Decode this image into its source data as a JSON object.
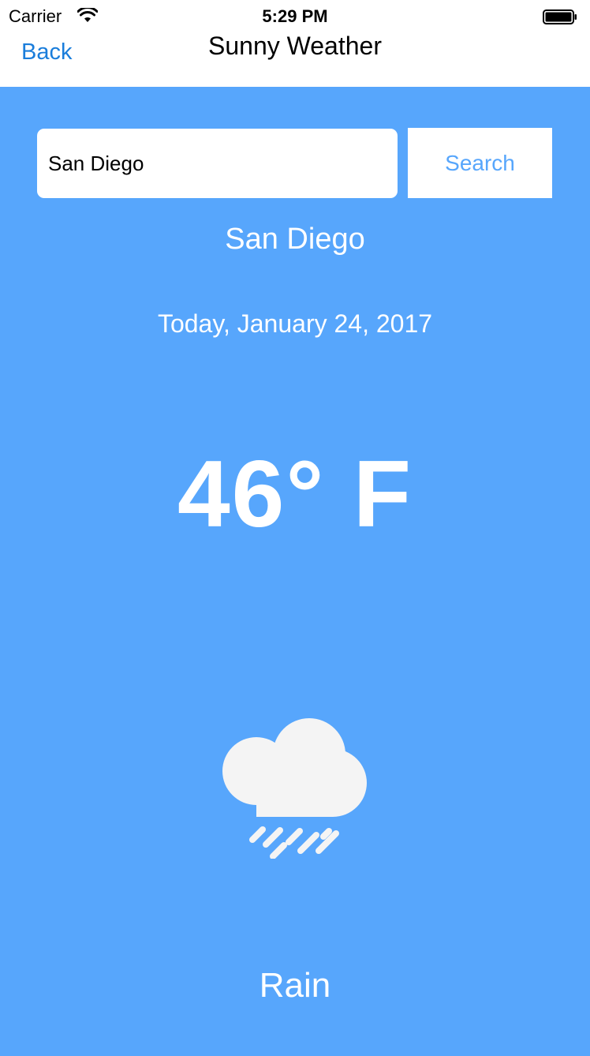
{
  "status_bar": {
    "carrier": "Carrier",
    "time": "5:29 PM",
    "wifi_icon": "wifi-icon",
    "battery_icon": "battery-icon"
  },
  "nav": {
    "back_label": "Back",
    "title": "Sunny Weather"
  },
  "search": {
    "value": "San Diego",
    "button_label": "Search"
  },
  "weather": {
    "city": "San Diego",
    "date": "Today, January 24, 2017",
    "temperature": "46° F",
    "condition": "Rain",
    "icon": "rain-cloud-icon"
  },
  "colors": {
    "background": "#57a6fc",
    "nav_tint": "#1a7ddb",
    "text_on_background": "#ffffff"
  }
}
